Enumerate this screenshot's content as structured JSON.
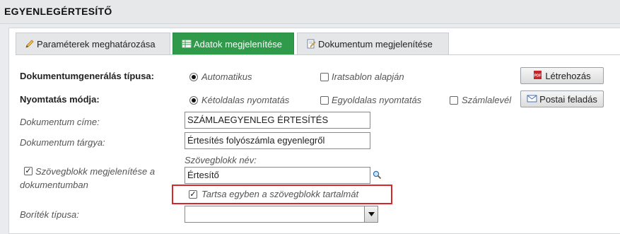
{
  "header": {
    "title": "EGYENLEGÉRTESÍTŐ"
  },
  "tabs": [
    {
      "label": "Paraméterek meghatározása",
      "icon": "pencil-icon"
    },
    {
      "label": "Adatok megjelenítése",
      "icon": "table-icon"
    },
    {
      "label": "Dokumentum megjelenítése",
      "icon": "document-edit-icon"
    }
  ],
  "form": {
    "doc_type_label": "Dokumentumgenerálás típusa:",
    "doc_type_options": [
      "Automatikus",
      "Iratsablon alapján"
    ],
    "print_mode_label": "Nyomtatás módja:",
    "print_mode_options": [
      "Kétoldalas nyomtatás",
      "Egyoldalas nyomtatás"
    ],
    "szamlalevel_label": "Számlalevél",
    "title_label": "Dokumentum címe:",
    "title_value": "SZÁMLAEGYENLEG ÉRTESÍTÉS",
    "subject_label": "Dokumentum tárgya:",
    "subject_value": "Értesítés folyószámla egyenlegről",
    "textblock_name_label": "Szövegblokk név:",
    "textblock_show_label_1": "Szövegblokk megjelenítése a",
    "textblock_show_label_2": "dokumentumban",
    "textblock_value": "Értesítő",
    "keep_together_label": "Tartsa egyben a szövegblokk tartalmát",
    "envelope_label": "Boríték típusa:",
    "envelope_value": ""
  },
  "buttons": {
    "create": "Létrehozás",
    "postal": "Postai feladás"
  }
}
